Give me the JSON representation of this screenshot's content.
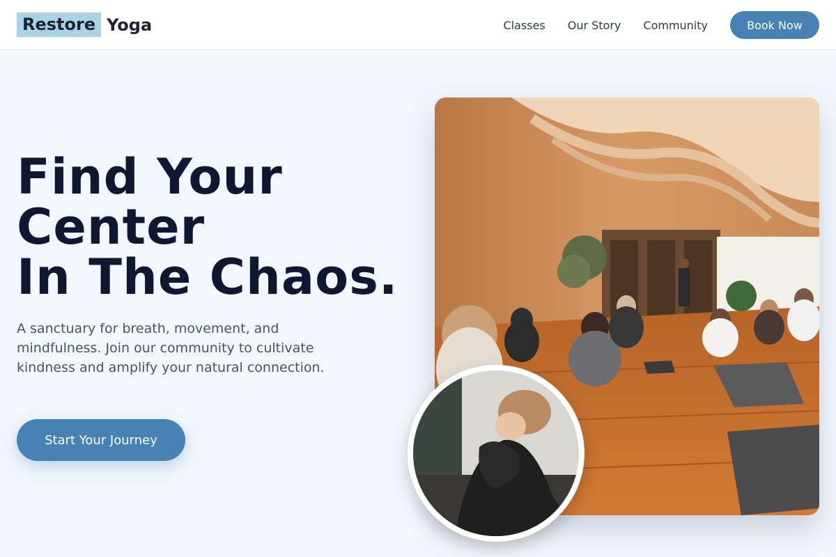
{
  "brand": {
    "highlight": "Restore",
    "rest": "Yoga"
  },
  "nav": {
    "links": [
      "Classes",
      "Our Story",
      "Community"
    ],
    "cta": "Book Now"
  },
  "hero": {
    "headline": [
      "Find Your",
      "Center",
      "In The Chaos."
    ],
    "description": "A sanctuary for breath, movement, and mindfulness. Join our community to cultivate kindness and amplify your natural connection.",
    "cta": "Start Your Journey"
  },
  "colors": {
    "accent": "#4782b4",
    "logo_highlight": "#a9d3e6",
    "page_bg": "#f1f7fd",
    "heading": "#0f1830"
  }
}
